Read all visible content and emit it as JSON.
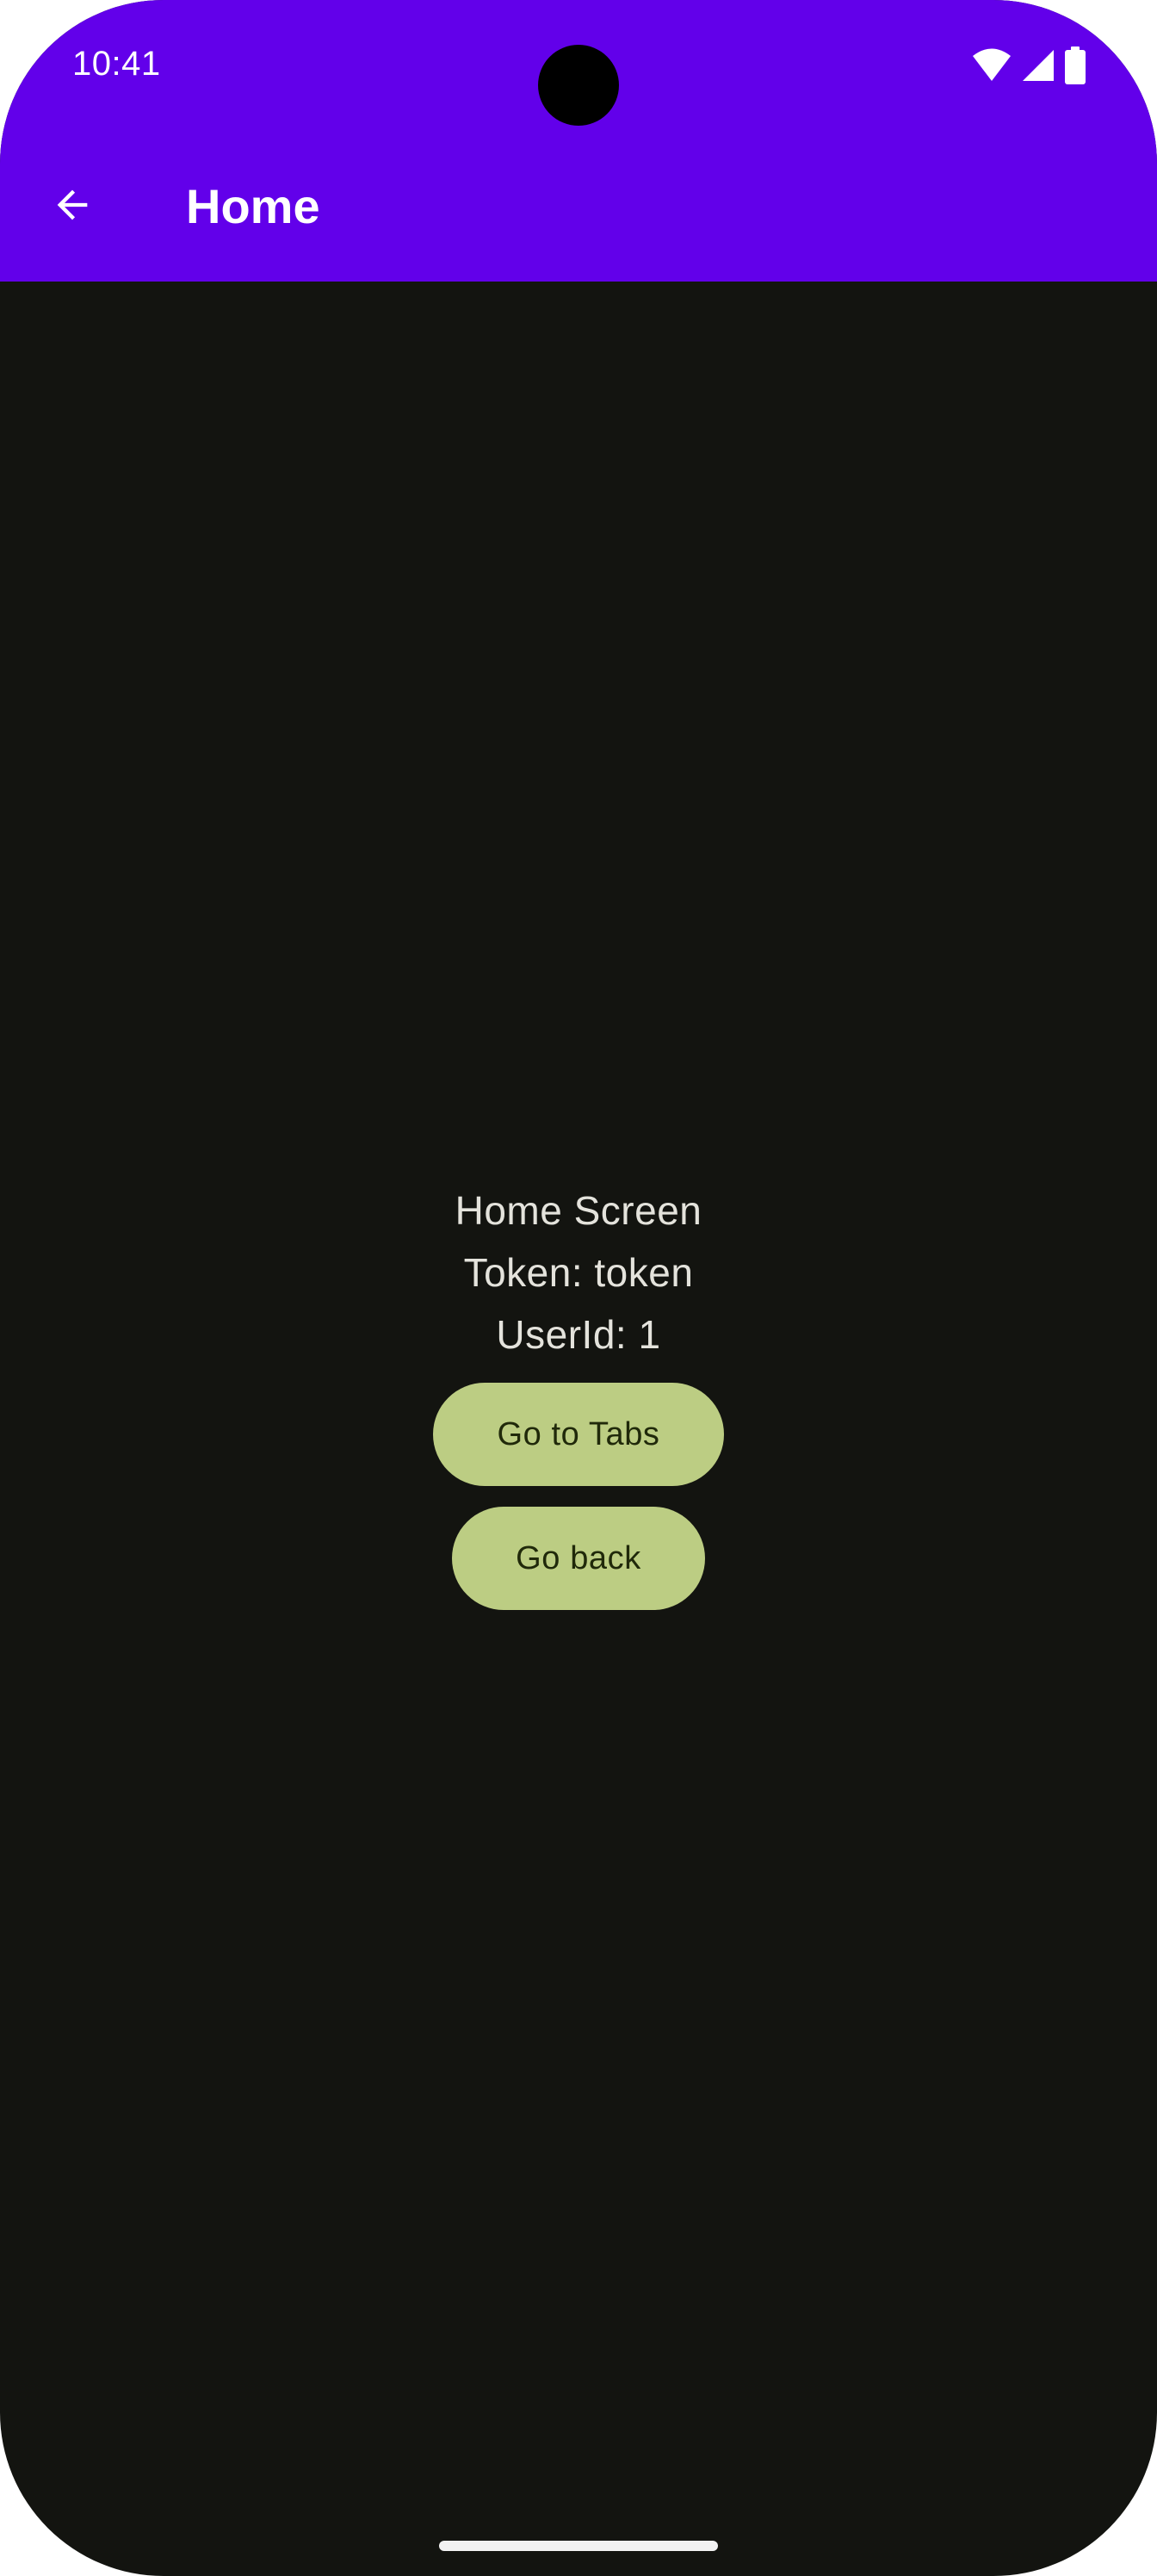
{
  "status_bar": {
    "time": "10:41",
    "icons": [
      "wifi-icon",
      "signal-icon",
      "battery-icon"
    ]
  },
  "app_bar": {
    "back_icon": "arrow-back-icon",
    "title": "Home",
    "color": "#6200ea"
  },
  "screen": {
    "heading": "Home Screen",
    "token_line": "Token: token",
    "userid_line": "UserId: 1",
    "background": "#131410"
  },
  "buttons": {
    "go_to_tabs": "Go to Tabs",
    "go_back": "Go back",
    "color": "#bccd83"
  }
}
